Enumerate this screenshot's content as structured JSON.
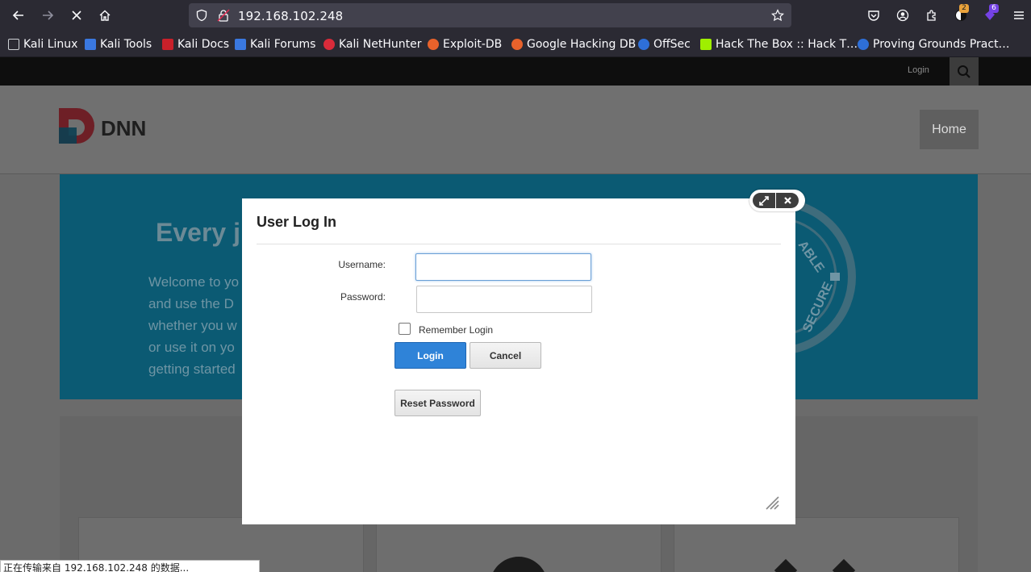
{
  "browser": {
    "url": "192.168.102.248",
    "badges": {
      "extension_count_orange": "2",
      "extension_count_purple": "6"
    },
    "bookmarks": [
      {
        "label": "Kali Linux",
        "icon": "kali-dragon-icon"
      },
      {
        "label": "Kali Tools",
        "icon": "kali-tools-icon"
      },
      {
        "label": "Kali Docs",
        "icon": "kali-docs-icon"
      },
      {
        "label": "Kali Forums",
        "icon": "kali-forums-icon"
      },
      {
        "label": "Kali NetHunter",
        "icon": "nethunter-icon"
      },
      {
        "label": "Exploit-DB",
        "icon": "exploit-db-icon"
      },
      {
        "label": "Google Hacking DB",
        "icon": "ghdb-icon"
      },
      {
        "label": "OffSec",
        "icon": "offsec-icon"
      },
      {
        "label": "Hack The Box :: Hack T…",
        "icon": "htb-icon"
      },
      {
        "label": "Proving Grounds Pract…",
        "icon": "pg-icon"
      }
    ],
    "status_text": "正在传输来自 192.168.102.248 的数据..."
  },
  "site": {
    "topbar_login": "Login",
    "nav_home": "Home",
    "banner_title": "Every j",
    "banner_lines": [
      "Welcome to yo",
      "and use the D",
      "whether you w",
      "or use it on yo",
      "getting started"
    ],
    "banner_badge_words": [
      "ABLE",
      "SECURE"
    ]
  },
  "modal": {
    "title": "User Log In",
    "username_label": "Username:",
    "password_label": "Password:",
    "username_value": "",
    "password_value": "",
    "remember_label": "Remember Login",
    "login_button": "Login",
    "cancel_button": "Cancel",
    "reset_button": "Reset Password"
  },
  "colors": {
    "browser_chrome": "#2b2a33",
    "urlbar": "#42414d",
    "primary_button": "#2f83d8",
    "banner": "#0b5a73"
  }
}
